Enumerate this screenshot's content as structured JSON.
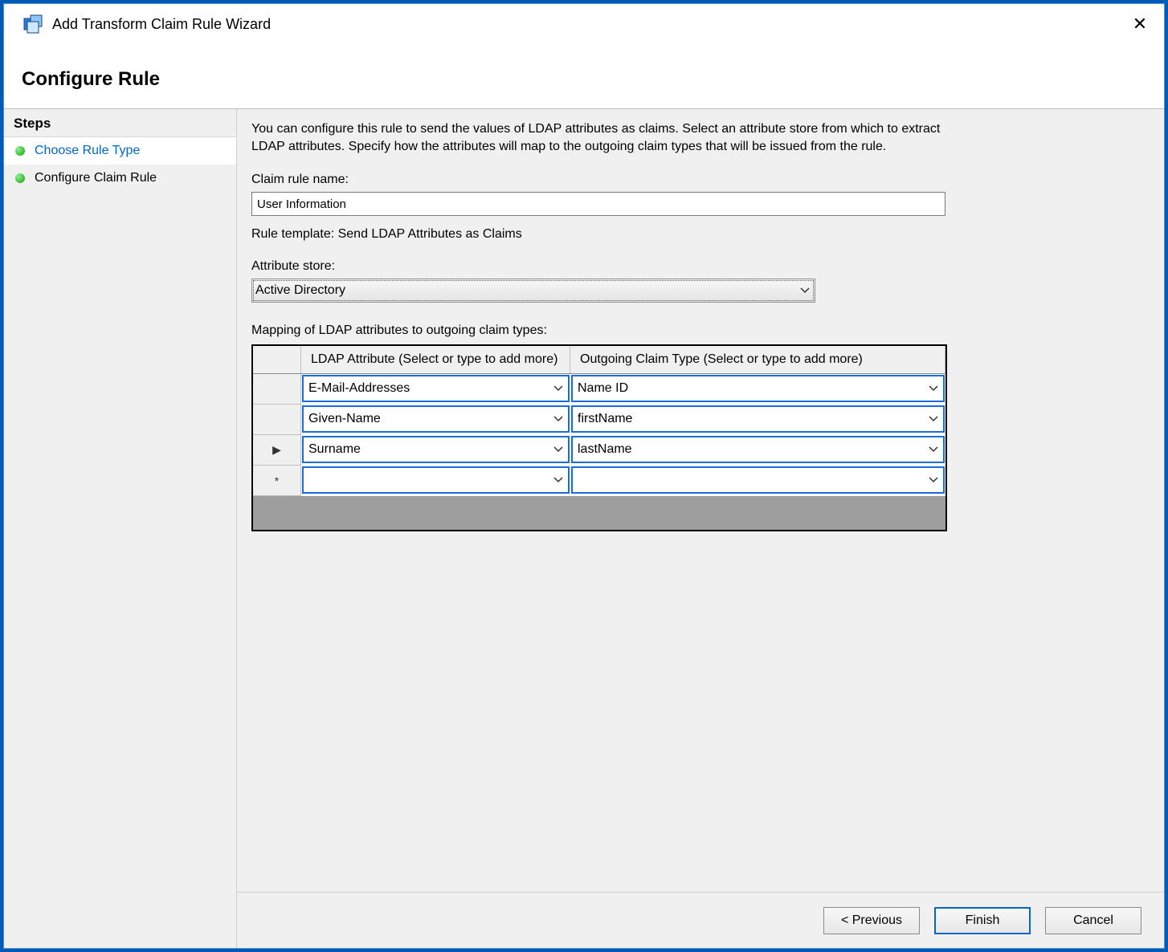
{
  "window": {
    "title": "Add Transform Claim Rule Wizard",
    "close_icon": "✕"
  },
  "header": {
    "title": "Configure Rule"
  },
  "steps": {
    "header": "Steps",
    "items": [
      {
        "label": "Choose Rule Type"
      },
      {
        "label": "Configure Claim Rule"
      }
    ]
  },
  "content": {
    "description": "You can configure this rule to send the values of LDAP attributes as claims. Select an attribute store from which to extract LDAP attributes. Specify how the attributes will map to the outgoing claim types that will be issued from the rule.",
    "claim_rule_name_label": "Claim rule name:",
    "claim_rule_name_value": "User Information",
    "rule_template_label": "Rule template: Send LDAP Attributes as Claims",
    "attribute_store_label": "Attribute store:",
    "attribute_store_value": "Active Directory",
    "mapping_label": "Mapping of LDAP attributes to outgoing claim types:",
    "mapping_columns": {
      "col1": "LDAP Attribute (Select or type to add more)",
      "col2": "Outgoing Claim Type (Select or type to add more)"
    },
    "mapping_rows": [
      {
        "marker": "",
        "ldap": "E-Mail-Addresses",
        "claim": "Name ID"
      },
      {
        "marker": "",
        "ldap": "Given-Name",
        "claim": "firstName"
      },
      {
        "marker": "▶",
        "ldap": "Surname",
        "claim": "lastName"
      },
      {
        "marker": "*",
        "ldap": "",
        "claim": ""
      }
    ]
  },
  "buttons": {
    "previous": "< Previous",
    "finish": "Finish",
    "cancel": "Cancel"
  }
}
